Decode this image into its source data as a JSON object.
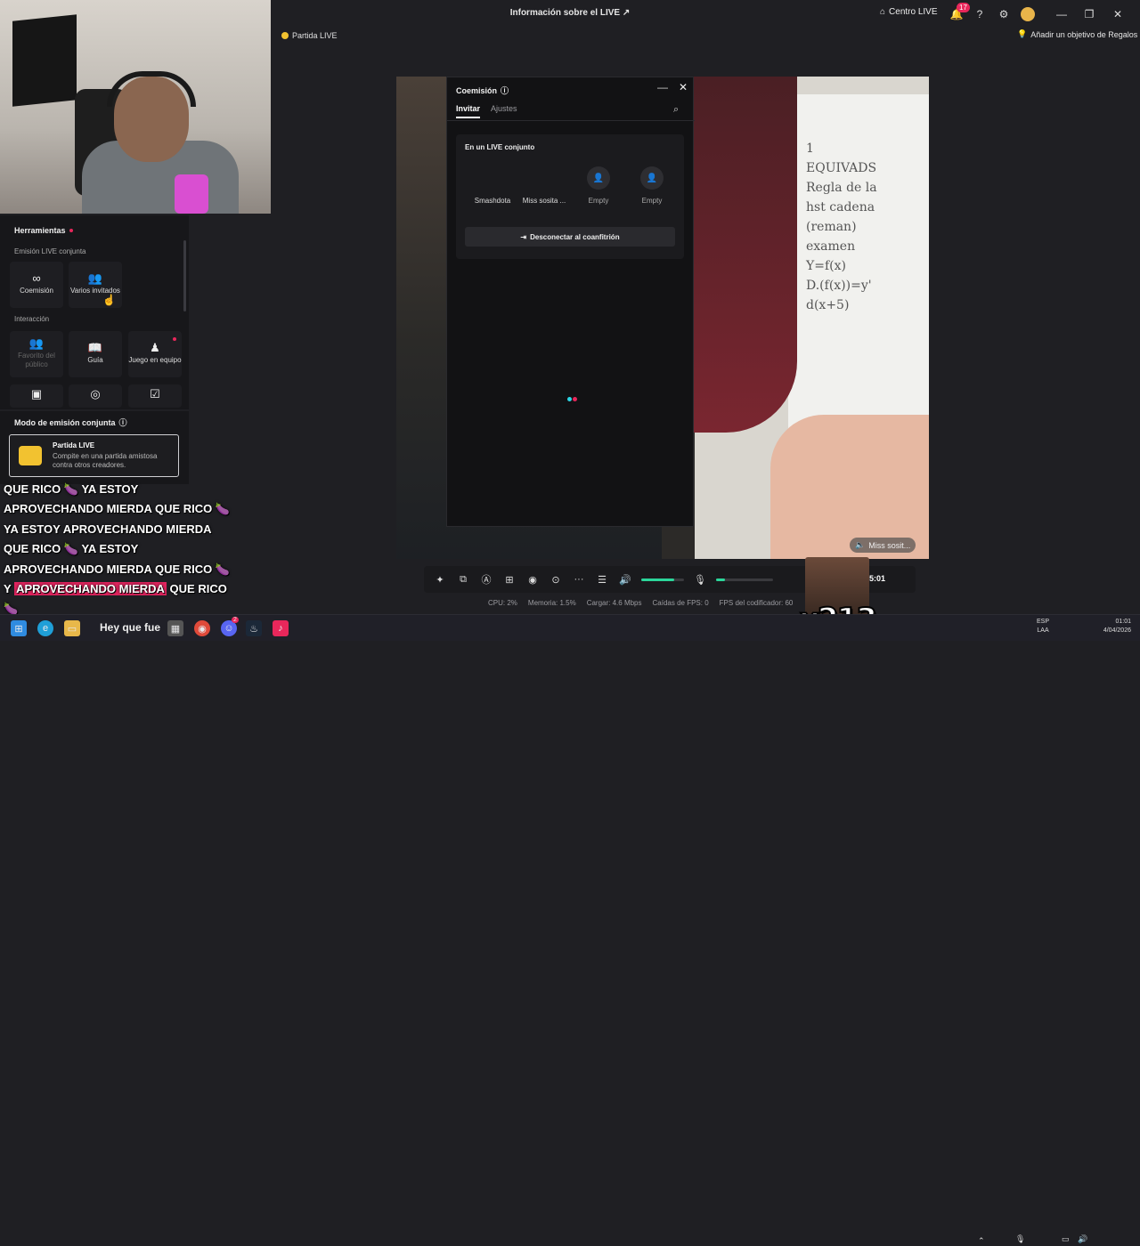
{
  "window": {
    "title": "Información sobre el LIVE",
    "centro_label": "Centro LIVE",
    "notif_count": "17"
  },
  "top_left_chip": "Partida LIVE",
  "regalos_label": "Añadir un objetivo de Regalos",
  "coemision": {
    "title": "Coemisión",
    "tabs": [
      "Invitar",
      "Ajustes"
    ],
    "live_title": "En un LIVE conjunto",
    "slots": [
      "Smashdota",
      "Miss sosita ...",
      "Empty",
      "Empty"
    ],
    "disconnect_label": "Desconectar al coanfitrión"
  },
  "tools": {
    "title": "Herramientas",
    "section1": "Emisión LIVE conjunta",
    "items1": [
      "Coemisión",
      "Varios invitados"
    ],
    "section2": "Interacción",
    "items2": [
      "Favorito del público",
      "Guía",
      "Juego en equipo"
    ]
  },
  "modo": {
    "title": "Modo de emisión conjunta",
    "card_title": "Partida LIVE",
    "card_desc": "Compite en una partida amistosa contra otros creadores."
  },
  "caption": {
    "l1": "QUE RICO 🍆 YA ESTOY",
    "l2": "APROVECHANDO MIERDA QUE RICO 🍆",
    "l3": "YA ESTOY APROVECHANDO MIERDA",
    "l4": "QUE RICO 🍆 YA ESTOY",
    "l5": "APROVECHANDO MIERDA QUE RICO 🍆",
    "l6a": "Y",
    "l6b": "APROVECHANDO MIERDA",
    "l6c": "QUE RICO",
    "l7": "🍆"
  },
  "preview_chip": "Miss sosit...",
  "whiteboard_text": "1\nEQUIVADS\nRegla de la\nhst cadena\n(reman)\nexamen\nY=f(x)\nD.(f(x))=y'\nd(x+5)",
  "statusbar": {
    "volume": 0.78,
    "mic_level": 0.15,
    "timer": "5:01",
    "metrics": [
      "CPU:  2%",
      "Memoria:  1.5%",
      "Cargar:  4.6 Mbps",
      "Caídas de FPS:  0",
      "FPS del codificador:  60"
    ]
  },
  "meme_count": "x213",
  "taskbar": {
    "hey_text": "Hey que fue",
    "steam_badge": "2",
    "lang": "ESP",
    "lang2": "LAA",
    "time": "01:01",
    "date": "4/04/2026"
  },
  "colors": {
    "accent": "#e8275b",
    "teal": "#2bd69a",
    "gold": "#f2c230"
  }
}
